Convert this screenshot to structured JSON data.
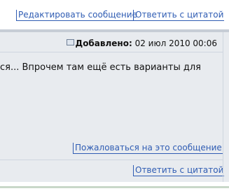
{
  "top_actions": {
    "edit_label": "Редактировать сообщение",
    "quote_label": "Ответить с цитатой"
  },
  "post": {
    "added_label": "Добавлено:",
    "added_date": "02 июл 2010 00:06",
    "body_text": "ся... Впрочем там ещё есть варианты для",
    "report_label": "Пожаловаться на это сообщение",
    "quote_label": "Ответить с цитатой"
  },
  "colors": {
    "link": "#2f5cb3",
    "post_background": "#e8ebef",
    "separator": "#c7cdd6"
  }
}
